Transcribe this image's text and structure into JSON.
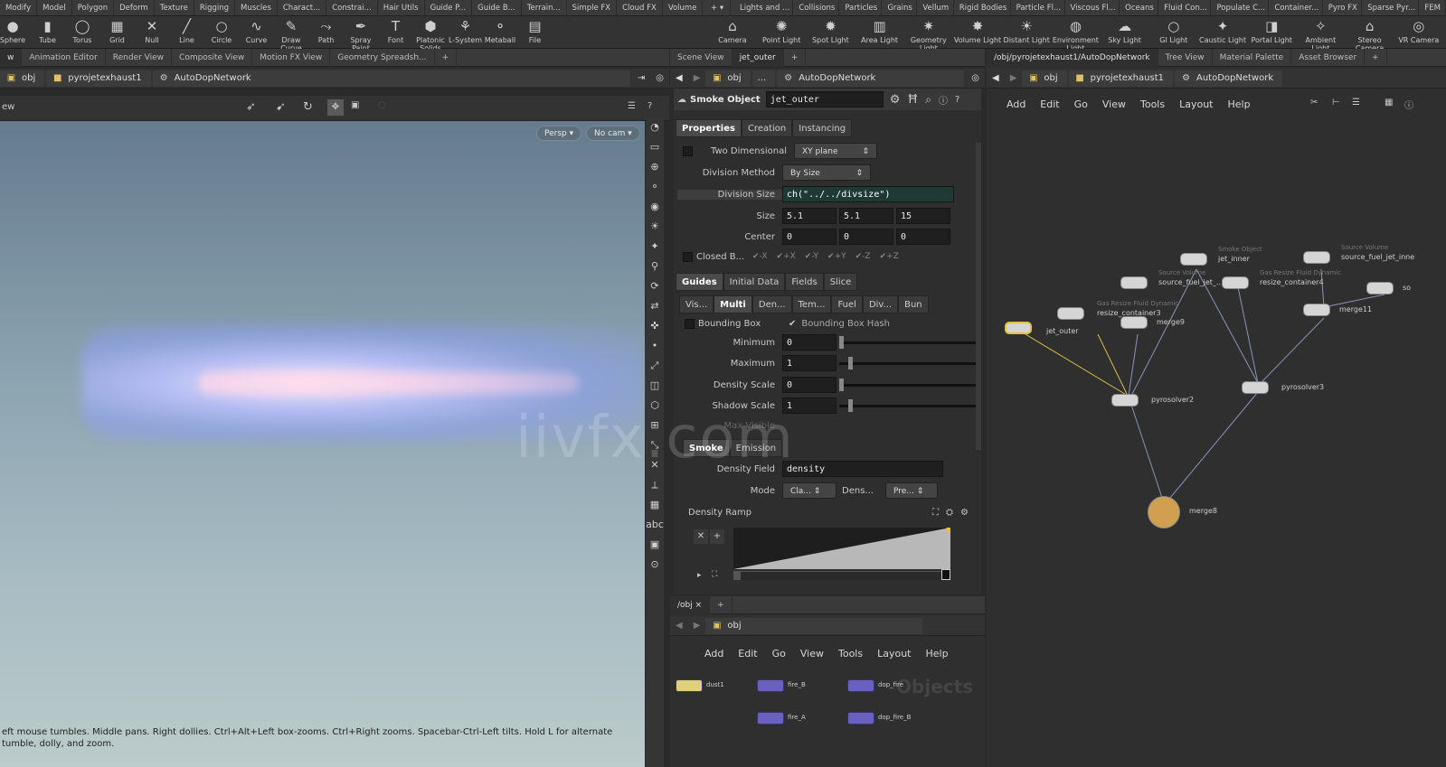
{
  "shelf_tabs_left": [
    "Modify",
    "Model",
    "Polygon",
    "Deform",
    "Texture",
    "Rigging",
    "Muscles",
    "Charact...",
    "Constrai...",
    "Hair Utils",
    "Guide P...",
    "Guide B...",
    "Terrain...",
    "Simple FX",
    "Cloud FX",
    "Volume"
  ],
  "shelf_tabs_right": [
    "Lights and ...",
    "Collisions",
    "Particles",
    "Grains",
    "Vellum",
    "Rigid Bodies",
    "Particle Fl...",
    "Viscous Fl...",
    "Oceans",
    "Fluid Con...",
    "Populate C...",
    "Container...",
    "Pyro FX",
    "Sparse Pyr...",
    "FEM"
  ],
  "shelf_tools_left": [
    {
      "label": "Sphere",
      "icon": "●"
    },
    {
      "label": "Tube",
      "icon": "▮"
    },
    {
      "label": "Torus",
      "icon": "◯"
    },
    {
      "label": "Grid",
      "icon": "▦"
    },
    {
      "label": "Null",
      "icon": "✕"
    },
    {
      "label": "Line",
      "icon": "╱"
    },
    {
      "label": "Circle",
      "icon": "○"
    },
    {
      "label": "Curve",
      "icon": "∿"
    },
    {
      "label": "Draw Curve",
      "icon": "✎"
    },
    {
      "label": "Path",
      "icon": "⤳"
    },
    {
      "label": "Spray Paint",
      "icon": "✒"
    },
    {
      "label": "Font",
      "icon": "T"
    },
    {
      "label": "Platonic Solids",
      "icon": "⬢"
    },
    {
      "label": "L-System",
      "icon": "⚘"
    },
    {
      "label": "Metaball",
      "icon": "⚬"
    },
    {
      "label": "File",
      "icon": "▤"
    }
  ],
  "shelf_tools_right": [
    {
      "label": "Camera",
      "icon": "⌂"
    },
    {
      "label": "Point Light",
      "icon": "✺"
    },
    {
      "label": "Spot Light",
      "icon": "✹"
    },
    {
      "label": "Area Light",
      "icon": "▥"
    },
    {
      "label": "Geometry Light",
      "icon": "✷"
    },
    {
      "label": "Volume Light",
      "icon": "✸"
    },
    {
      "label": "Distant Light",
      "icon": "☀"
    },
    {
      "label": "Environment Light",
      "icon": "◍"
    },
    {
      "label": "Sky Light",
      "icon": "☁"
    },
    {
      "label": "GI Light",
      "icon": "○"
    },
    {
      "label": "Caustic Light",
      "icon": "✦"
    },
    {
      "label": "Portal Light",
      "icon": "◨"
    },
    {
      "label": "Ambient Light",
      "icon": "✧"
    },
    {
      "label": "Stereo Camera",
      "icon": "⌂"
    },
    {
      "label": "VR Camera",
      "icon": "◎"
    }
  ],
  "left_tabs": [
    "w",
    "Animation Editor",
    "Render View",
    "Composite View",
    "Motion FX View",
    "Geometry Spreadsh..."
  ],
  "left_path": {
    "root": "obj",
    "object": "pyrojetexhaust1",
    "network": "AutoDopNetwork"
  },
  "left_toolbar_title": "ew",
  "viewport": {
    "persp": "Persp",
    "cam": "No cam"
  },
  "viewport_hint": "eft mouse tumbles. Middle pans. Right dollies. Ctrl+Alt+Left box-zooms. Ctrl+Right zooms. Spacebar-Ctrl-Left tilts. Hold L for alternate tumble, dolly, and zoom.",
  "mid_tabs": [
    "Scene View",
    "jet_outer"
  ],
  "mid_path": {
    "root": "obj",
    "dots": "...",
    "network": "AutoDopNetwork"
  },
  "param": {
    "type_label": "Smoke Object",
    "name": "jet_outer",
    "tabs": [
      "Properties",
      "Creation",
      "Instancing"
    ],
    "two_dimensional": "Two Dimensional",
    "plane": "XY plane",
    "division_method_label": "Division Method",
    "division_method": "By Size",
    "division_size_label": "Division Size",
    "division_size": "ch(\"../../divsize\")",
    "size_label": "Size",
    "size": [
      "5.1",
      "5.1",
      "15"
    ],
    "center_label": "Center",
    "center": [
      "0",
      "0",
      "0"
    ],
    "closed_label": "Closed B...",
    "closed_flags": [
      "-X",
      "+X",
      "-Y",
      "+Y",
      "-Z",
      "+Z"
    ],
    "tabs2": [
      "Guides",
      "Initial Data",
      "Fields",
      "Slice"
    ],
    "tabs3": [
      "Vis...",
      "Multi",
      "Den...",
      "Tem...",
      "Fuel",
      "Div...",
      "Bun"
    ],
    "bounding_box": "Bounding Box",
    "bounding_box_hash": "Bounding Box Hash",
    "minimum_label": "Minimum",
    "minimum": "0",
    "maximum_label": "Maximum",
    "maximum": "1",
    "density_scale_label": "Density Scale",
    "density_scale": "0",
    "shadow_scale_label": "Shadow Scale",
    "shadow_scale": "1",
    "max_visible": "Max Visible",
    "tabs4": [
      "Smoke",
      "Emission"
    ],
    "density_field_label": "Density Field",
    "density_field": "density",
    "mode_label": "Mode",
    "mode": "Cla...",
    "dens_label": "Dens...",
    "pre": "Pre...",
    "density_ramp": "Density Ramp"
  },
  "obj_pane": {
    "tab": "/obj",
    "path": "obj",
    "menu": [
      "Add",
      "Edit",
      "Go",
      "View",
      "Tools",
      "Layout",
      "Help"
    ],
    "watermark": "Objects",
    "nodes": [
      "dust1",
      "fire_B",
      "dop_fire",
      "fire_A",
      "dop_fire_B"
    ]
  },
  "right_tabs": [
    "/obj/pyrojetexhaust1/AutoDopNetwork",
    "Tree View",
    "Material Palette",
    "Asset Browser"
  ],
  "right_path": {
    "root": "obj",
    "object": "pyrojetexhaust1",
    "network": "AutoDopNetwork"
  },
  "net_menu": [
    "Add",
    "Edit",
    "Go",
    "View",
    "Tools",
    "Layout",
    "Help"
  ],
  "net_nodes": [
    {
      "label": "jet_outer",
      "comment": ""
    },
    {
      "label": "resize_container3",
      "comment": "Gas Resize Fluid Dynamic"
    },
    {
      "label": "source_fuel_jet_...",
      "comment": "Source Volume"
    },
    {
      "label": "jet_inner",
      "comment": "Smoke Object"
    },
    {
      "label": "resize_container4",
      "comment": "Gas Resize Fluid Dynamic"
    },
    {
      "label": "source_fuel_jet_inne",
      "comment": "Source Volume"
    },
    {
      "label": "merge9",
      "comment": ""
    },
    {
      "label": "merge11",
      "comment": ""
    },
    {
      "label": "pyrosolver2",
      "comment": ""
    },
    {
      "label": "pyrosolver3",
      "comment": ""
    },
    {
      "label": "merge8",
      "comment": ""
    },
    {
      "label": "so",
      "comment": ""
    }
  ],
  "watermark": "iivfx.com"
}
